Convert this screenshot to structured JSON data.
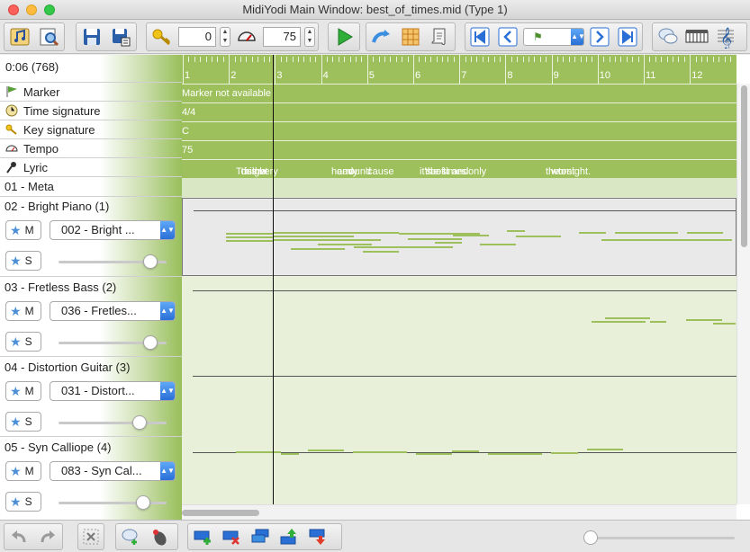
{
  "window": {
    "title": "MidiYodi Main Window: best_of_times.mid (Type 1)"
  },
  "toolbar": {
    "transpose_value": "0",
    "tempo_value": "75",
    "icons": [
      "music-notes-icon",
      "inspect-icon",
      "save-icon",
      "save-as-icon",
      "key-icon",
      "speedometer-icon",
      "play-icon",
      "repeat-icon",
      "grid-icon",
      "scroll-icon",
      "first-icon",
      "previous-icon",
      "marker-nav-icon",
      "next-icon",
      "last-icon",
      "chat-icon",
      "piano-icon",
      "treble-clef-icon"
    ]
  },
  "header": {
    "time_position": "0:06 (768)"
  },
  "control_rows": [
    {
      "label": "Marker",
      "icon": "marker-flag-icon",
      "lane_text": "Marker not available"
    },
    {
      "label": "Time signature",
      "icon": "clock-icon",
      "lane_text": "4/4"
    },
    {
      "label": "Key signature",
      "icon": "key-icon",
      "lane_text": "C"
    },
    {
      "label": "Tempo",
      "icon": "speedometer-icon",
      "lane_text": "75"
    },
    {
      "label": "Lyric",
      "icon": "microphone-icon",
      "lane_text": ""
    }
  ],
  "lyrics": [
    "Tonight",
    "this",
    "is",
    "the",
    "very",
    "heavy",
    "and",
    "round",
    "'cause",
    "it's",
    "the",
    "best",
    "of",
    "times",
    "and",
    "only",
    "the",
    "worst",
    "tonight."
  ],
  "meta_track": {
    "label": "01 - Meta"
  },
  "tracks": [
    {
      "name": "02 - Bright Piano (1)",
      "program": "002 - Bright ...",
      "mute": "M",
      "solo": "S",
      "volume": 0.85,
      "selected": true
    },
    {
      "name": "03 - Fretless Bass (2)",
      "program": "036 - Fretles...",
      "mute": "M",
      "solo": "S",
      "volume": 0.85,
      "selected": false
    },
    {
      "name": "04 - Distortion Guitar (3)",
      "program": "031 - Distort...",
      "mute": "M",
      "solo": "S",
      "volume": 0.75,
      "selected": false
    },
    {
      "name": "05 - Syn Calliope (4)",
      "program": "083 - Syn Cal...",
      "mute": "M",
      "solo": "S",
      "volume": 0.78,
      "selected": false
    }
  ],
  "ruler": {
    "measures": [
      "1",
      "2",
      "3",
      "4",
      "5",
      "6",
      "7",
      "8",
      "9",
      "10",
      "11",
      "12"
    ]
  },
  "bottombar": {
    "icons": [
      "undo-icon",
      "redo-icon",
      "delete-icon",
      "add-comment-icon",
      "mouse-icon",
      "add-track-icon",
      "remove-track-icon",
      "duplicate-track-icon",
      "move-track-up-icon",
      "move-track-down-icon"
    ],
    "zoom": 0.0
  },
  "colors": {
    "lane_green": "#9dc05c",
    "lane_bg": "#e8f0da",
    "accent_blue": "#2a6fd6"
  }
}
